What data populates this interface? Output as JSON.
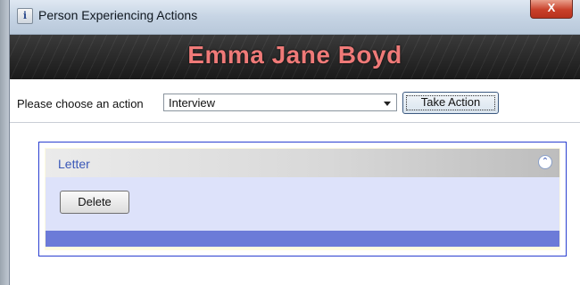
{
  "window": {
    "title": "Person Experiencing Actions",
    "icon": "info-icon",
    "close_label": "X"
  },
  "banner": {
    "name": "Emma Jane Boyd"
  },
  "action_row": {
    "label": "Please choose an action",
    "select_value": "Interview",
    "take_action_label": "Take Action"
  },
  "panel": {
    "title": "Letter",
    "collapse_icon": "double-chevron-up-icon",
    "delete_label": "Delete"
  },
  "colors": {
    "banner_name": "#ef7a78",
    "panel_border": "#2a3fd0",
    "panel_title": "#3a58b8",
    "panel_footer": "#6c7bd8"
  }
}
